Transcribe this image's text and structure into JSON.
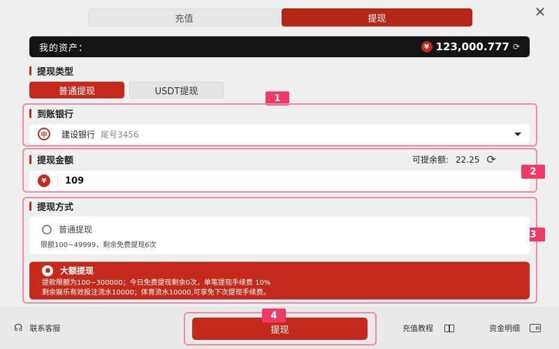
{
  "tabs": {
    "recharge": "充值",
    "withdraw": "提现"
  },
  "close_icon": "close-icon",
  "assets": {
    "label": "我的资产：",
    "currency_symbol": "¥",
    "value": "123,000.777"
  },
  "withdraw_type": {
    "title": "提现类型",
    "options": [
      "普通提现",
      "USDT提现"
    ],
    "selected": "普通提现"
  },
  "bank_section": {
    "badge": "1",
    "title": "到账银行",
    "bank_name": "建设银行",
    "tail": "尾号3456",
    "logo_glyph": "中"
  },
  "amount_section": {
    "badge": "2",
    "title": "提现金额",
    "available_label": "可提余额:",
    "available_value": "22.25",
    "currency_symbol": "¥",
    "input_value": "109"
  },
  "method_section": {
    "badge": "3",
    "title": "提现方式",
    "normal": {
      "label": "普通提现",
      "desc": "限额100~49999，剩余免费提现6次",
      "selected": false
    },
    "large": {
      "label": "大额提现",
      "desc_line1": "提款限额为100~300000；今日免费提现剩余0次，单笔提现手续费 10%",
      "desc_line2": "剩余娱乐有效投注流水10000；体育流水10000,可享免下次提现手续费。",
      "selected": true
    }
  },
  "footer": {
    "badge": "4",
    "support_label": "联系客服",
    "submit_label": "提现",
    "tutorial_label": "充值教程",
    "details_label": "资金明细"
  },
  "colors": {
    "brand_red": "#c4291b",
    "highlight_pink": "#ef8aa6",
    "badge_pink": "#ef3b63",
    "asset_bar": "#141414"
  }
}
